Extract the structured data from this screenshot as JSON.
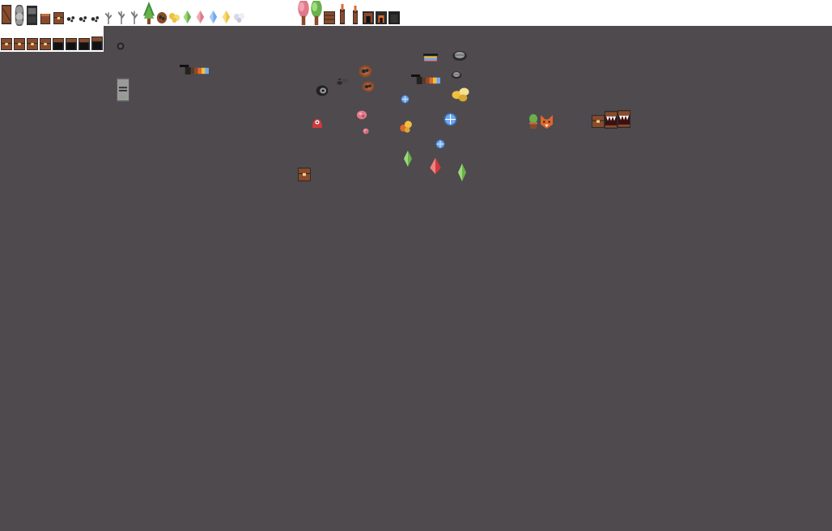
{
  "sheet": {
    "background_color": "#4e4a4e",
    "strip_color": "#ffffff"
  },
  "palette": {
    "brown": "#8a4b2a",
    "dark": "#2b2b2b",
    "gray": "#9a9a9a",
    "green": "#6ab04c",
    "pink": "#e07a8a",
    "yellow": "#f0c040",
    "blue": "#6fa8f0",
    "red": "#d23a3a",
    "orange": "#e0682a"
  },
  "sprites": [
    "brown-door-icon",
    "gray-coin-stack-icon",
    "dark-terminal-icon",
    "stump-icon",
    "chest-icon",
    "pebbles-icon",
    "sprout-icon",
    "tree-icon",
    "flower-icon",
    "crystal-icon",
    "pink-tree-icon",
    "green-tree-icon",
    "crate-icon",
    "torch-icon",
    "furnace-icon",
    "chest-row-icon",
    "ore-rock-icon",
    "computer-tower-icon",
    "gradient-bar-icon",
    "red-slime-icon",
    "blue-orb-icon",
    "gold-nugget-icon",
    "green-crystal-icon",
    "red-crystal-icon",
    "potted-plant-icon",
    "fox-icon",
    "mimic-chest-icon"
  ]
}
